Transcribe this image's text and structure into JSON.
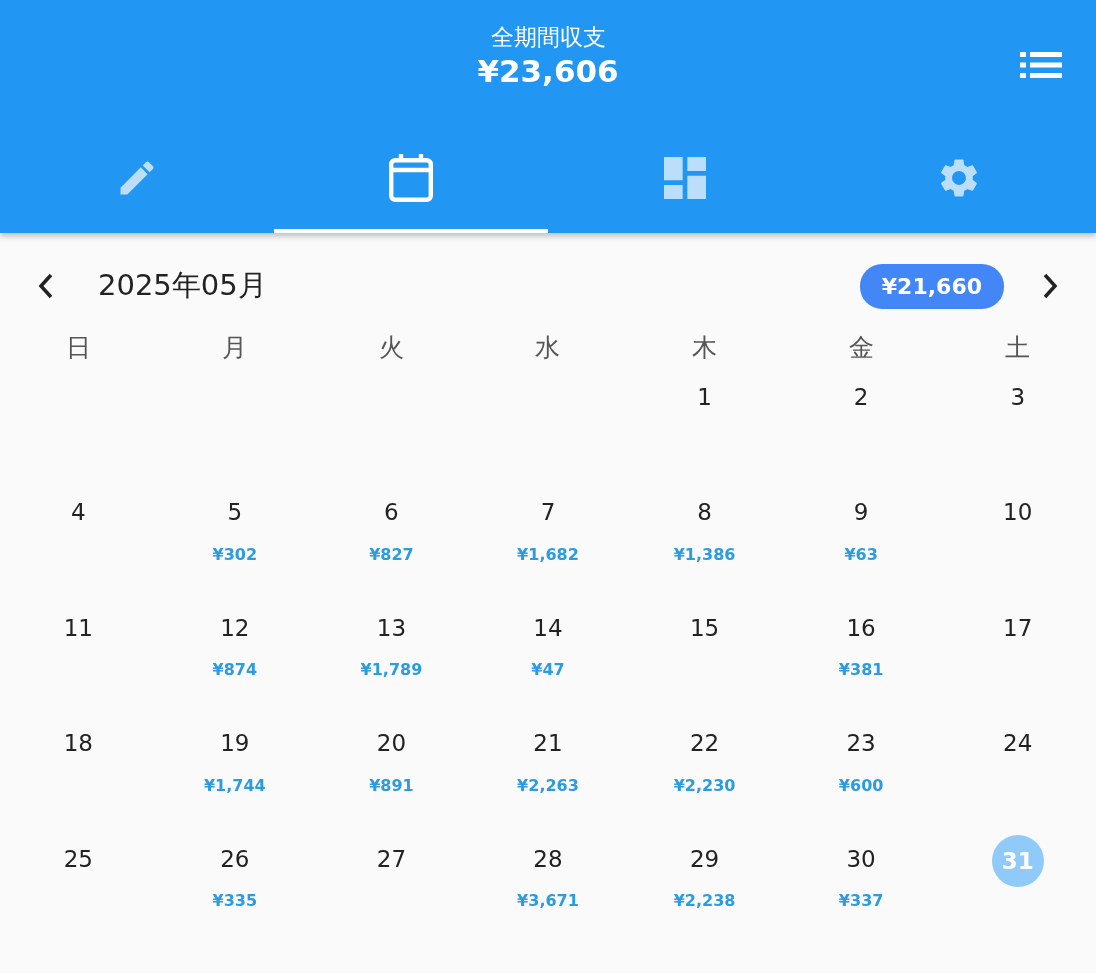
{
  "header": {
    "title": "全期間収支",
    "total": "¥23,606"
  },
  "tabs": [
    {
      "kind": "pencil",
      "selected": false
    },
    {
      "kind": "calendar",
      "selected": true
    },
    {
      "kind": "dashboard",
      "selected": false
    },
    {
      "kind": "settings",
      "selected": false
    }
  ],
  "month": {
    "label": "2025年05月",
    "total": "¥21,660"
  },
  "weekdays": [
    "日",
    "月",
    "火",
    "水",
    "木",
    "金",
    "土"
  ],
  "weeks": [
    [
      {
        "day": "1",
        "selected": false
      },
      {
        "day": "2",
        "selected": false
      },
      {
        "day": "3",
        "selected": false
      }
    ],
    [
      {
        "day": "4",
        "selected": false
      },
      {
        "day": "5",
        "amount": "¥302",
        "selected": false
      },
      {
        "day": "6",
        "amount": "¥827",
        "selected": false
      },
      {
        "day": "7",
        "amount": "¥1,682",
        "selected": false
      },
      {
        "day": "8",
        "amount": "¥1,386",
        "selected": false
      },
      {
        "day": "9",
        "amount": "¥63",
        "selected": false
      },
      {
        "day": "10",
        "selected": false
      }
    ],
    [
      {
        "day": "11",
        "selected": false
      },
      {
        "day": "12",
        "amount": "¥874",
        "selected": false
      },
      {
        "day": "13",
        "amount": "¥1,789",
        "selected": false
      },
      {
        "day": "14",
        "amount": "¥47",
        "selected": false
      },
      {
        "day": "15",
        "selected": false
      },
      {
        "day": "16",
        "amount": "¥381",
        "selected": false
      },
      {
        "day": "17",
        "selected": false
      }
    ],
    [
      {
        "day": "18",
        "selected": false
      },
      {
        "day": "19",
        "amount": "¥1,744",
        "selected": false
      },
      {
        "day": "20",
        "amount": "¥891",
        "selected": false
      },
      {
        "day": "21",
        "amount": "¥2,263",
        "selected": false
      },
      {
        "day": "22",
        "amount": "¥2,230",
        "selected": false
      },
      {
        "day": "23",
        "amount": "¥600",
        "selected": false
      },
      {
        "day": "24",
        "selected": false
      }
    ],
    [
      {
        "day": "25",
        "selected": false
      },
      {
        "day": "26",
        "amount": "¥335",
        "selected": false
      },
      {
        "day": "27",
        "selected": false
      },
      {
        "day": "28",
        "amount": "¥3,671",
        "selected": false
      },
      {
        "day": "29",
        "amount": "¥2,238",
        "selected": false
      },
      {
        "day": "30",
        "amount": "¥337",
        "selected": false
      },
      {
        "day": "31",
        "selected": true
      }
    ]
  ]
}
